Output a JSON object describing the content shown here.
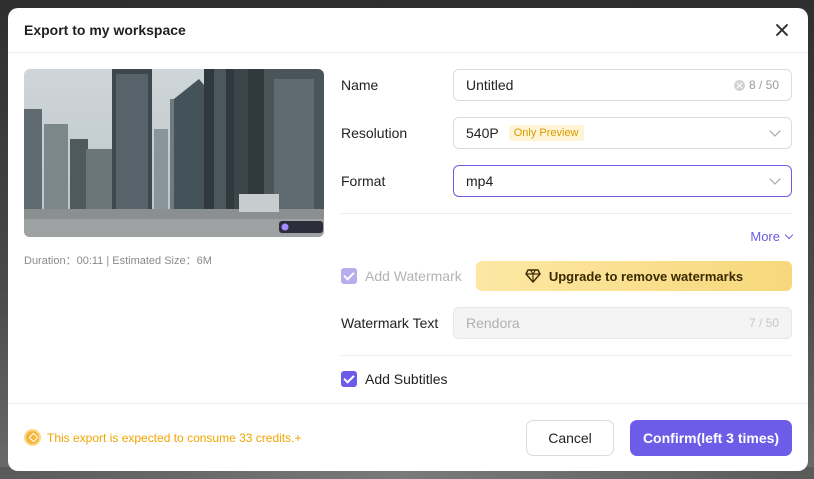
{
  "dialog": {
    "title": "Export to my workspace"
  },
  "preview": {
    "meta": "Duration：00:11 | Estimated Size：6M",
    "watermark_icon": "rendora-logo"
  },
  "form": {
    "name": {
      "label": "Name",
      "value": "Untitled",
      "counter": "8 / 50"
    },
    "resolution": {
      "label": "Resolution",
      "value": "540P",
      "badge": "Only Preview"
    },
    "format": {
      "label": "Format",
      "value": "mp4"
    },
    "more_label": "More",
    "watermark": {
      "label": "Add Watermark",
      "checked": true,
      "disabled": true
    },
    "upgrade_label": "Upgrade to remove watermarks",
    "watermark_text": {
      "label": "Watermark Text",
      "placeholder": "Rendora",
      "counter": "7 / 50"
    },
    "subtitles": {
      "label": "Add Subtitles",
      "checked": true
    }
  },
  "footer": {
    "credits_note": "This export is expected to consume 33 credits.+",
    "cancel_label": "Cancel",
    "confirm_label": "Confirm(left 3 times)"
  },
  "colors": {
    "accent": "#6c5ce7",
    "badge_text": "#d89a00",
    "credits_text": "#f0a500",
    "upgrade_bg": "#f7d87c"
  }
}
